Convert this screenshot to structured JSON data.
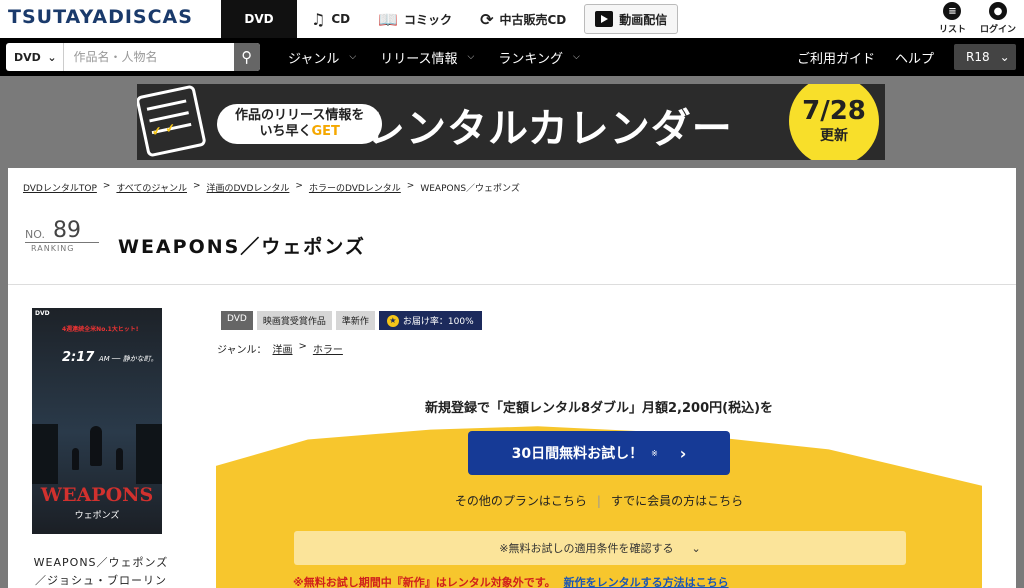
{
  "header": {
    "logo": "TSUTAYADISCAS",
    "categories": [
      {
        "label": "DVD",
        "icon": "dvd"
      },
      {
        "label": "CD",
        "icon": "music-note-icon"
      },
      {
        "label": "コミック",
        "icon": "book-icon"
      },
      {
        "label": "中古販売CD",
        "icon": "refresh-icon"
      },
      {
        "label": "動画配信",
        "icon": "play-icon"
      }
    ],
    "user_tools": [
      {
        "label": "リスト",
        "icon": "list-icon"
      },
      {
        "label": "ログイン",
        "icon": "user-icon"
      }
    ]
  },
  "navbar": {
    "search_category": "DVD",
    "search_placeholder": "作品名・人物名",
    "menu": [
      "ジャンル",
      "リリース情報",
      "ランキング"
    ],
    "right": [
      "ご利用ガイド",
      "ヘルプ"
    ],
    "r18": "R18"
  },
  "banner": {
    "pill_line1": "作品のリリース情報を",
    "pill_line2_prefix": "いち早く",
    "pill_line2_get": "GET",
    "headline": "レンタルカレンダー",
    "date": "7/28",
    "date_suffix": "更新"
  },
  "breadcrumb": [
    "DVDレンタルTOP",
    "すべてのジャンル",
    "洋画のDVDレンタル",
    "ホラーのDVDレンタル",
    "WEAPONS／ウェポンズ"
  ],
  "ranking": {
    "prefix": "NO.",
    "number": "89",
    "label": "RANKING"
  },
  "title": "WEAPONS／ウェポンズ",
  "poster": {
    "dvd_mark": "DVD",
    "tagline": "4週連続全米No.1大ヒット!",
    "time": "2:17",
    "time_suffix": "AM ── 静かな町。",
    "title": "WEAPONS",
    "subtitle": "ウェポンズ"
  },
  "poster_caption": "WEAPONS／ウェポンズ／ジョシュ・ブローリン",
  "badges": [
    "DVD",
    "映画賞受賞作品",
    "準新作"
  ],
  "delivery_rate": "お届け率：100%",
  "genre": {
    "label": "ジャンル：",
    "main": "洋画",
    "sub": "ホラー"
  },
  "promo": {
    "text": "新規登録で「定額レンタル8ダブル」月額2,200円(税込)を",
    "cta": "30日間無料お試し！",
    "cta_sup": "※",
    "link_other": "その他のプランはこちら",
    "link_member": "すでに会員の方はこちら",
    "conditions": "※無料お試しの適用条件を確認する",
    "notice": "※無料お試し期間中『新作』はレンタル対象外です。",
    "notice_link": "新作をレンタルする方法はこちら"
  }
}
